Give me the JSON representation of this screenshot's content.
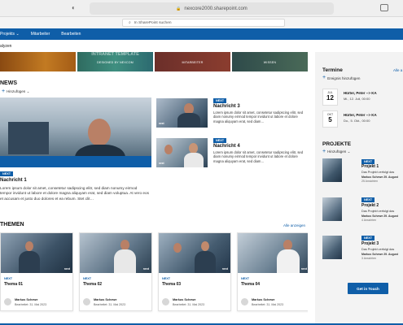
{
  "browser": {
    "url": "nexcore2000.sharepoint.com"
  },
  "suite": {
    "search_placeholder": "In SharePoint suchen"
  },
  "nav": {
    "items": [
      "Projekts ⌄",
      "Mitarbeiter",
      "Bearbeiten"
    ]
  },
  "breadcrumb": "alyzen",
  "hero": {
    "tile1_caption": "",
    "tile2_big": "INTRANET TEMPLATE",
    "tile2_caption": "DESIGNED BY NEXCOM",
    "tile3_caption": "MITARBEITER",
    "tile4_caption": "WISSEN"
  },
  "news": {
    "title": "NEWS",
    "add_label": "Hinzufügen ⌄",
    "main": {
      "badge": "NEXT",
      "title": "Nachricht 1",
      "text": "Lorem ipsum dolor sit amet, consetetur sadipscing elitr, sed diam nonumy eirmod tempor invidunt ut labore et dolore magna aliquyam erat, sed diam voluptua. At vero eos et accusam et justo duo dolores et ea rebum. Stet clit…"
    },
    "side": [
      {
        "badge": "NEXT",
        "title": "Nachricht 3",
        "text": "Lorem ipsum dolor sit amet, consetetur sadipscing elitr, sed diam nonumy eirmod tempor invidunt ut labore et dolore magna aliquyam erat, sed diam…"
      },
      {
        "badge": "NEXT",
        "title": "Nachricht 4",
        "text": "Lorem ipsum dolor sit amet, consetetur sadipscing elitr, sed diam nonumy eirmod tempor invidunt ut labore et dolore magna aliquyam erat, sed diam…"
      }
    ],
    "thumb_stamp": "next"
  },
  "themen": {
    "title": "THEMEN",
    "show_all": "Alle anzeigen",
    "cards": [
      {
        "label": "NEXT",
        "title": "Thema 01",
        "author": "Markus Schewe",
        "date": "Bearbeitet: 31. Mai 2023",
        "stamp": "next"
      },
      {
        "label": "NEXT",
        "title": "Thema 02",
        "author": "Markus Schewe",
        "date": "Bearbeitet: 31. Mai 2023",
        "stamp": "next"
      },
      {
        "label": "NEXT",
        "title": "Thema 03",
        "author": "Markus Schewe",
        "date": "Bearbeitet: 31. Mai 2023",
        "stamp": "next"
      },
      {
        "label": "NEXT",
        "title": "Thema 04",
        "author": "Markus Schewe",
        "date": "Bearbeitet: 31. Mai 2023",
        "stamp": "next"
      }
    ]
  },
  "termine": {
    "title": "Termine",
    "link": "Alle a",
    "add_label": "Ereignis hinzufügen",
    "events": [
      {
        "month": "JUL",
        "day": "12",
        "title": "Hürter, Peter --> KA",
        "date": "Mi., 12. Juli, 00:00"
      },
      {
        "month": "OKT",
        "day": "5",
        "title": "Hürter, Peter --> KA",
        "date": "Do., 5. Okt., 00:00"
      }
    ]
  },
  "projekte": {
    "title": "PROJEKTE",
    "add_label": "Hinzufügen ⌄",
    "items": [
      {
        "badge": "NEXT",
        "title": "Projekt 1",
        "desc": "Das Projekt verfolgt das",
        "author": "Markus Schewe 29. August",
        "views": "25 Ansichten"
      },
      {
        "badge": "NEXT",
        "title": "Projekt 2",
        "desc": "Das Projekt verfolgt das",
        "author": "Markus Schewe 29. August",
        "views": "4 Ansichten"
      },
      {
        "badge": "NEXT",
        "title": "Projekt 3",
        "desc": "Das Projekt verfolgt das",
        "author": "Markus Schewe 29. August",
        "views": "3 Ansichten"
      }
    ]
  },
  "cta": {
    "label": "Get in Touch"
  },
  "colors": {
    "accent": "#0f5ea8"
  }
}
